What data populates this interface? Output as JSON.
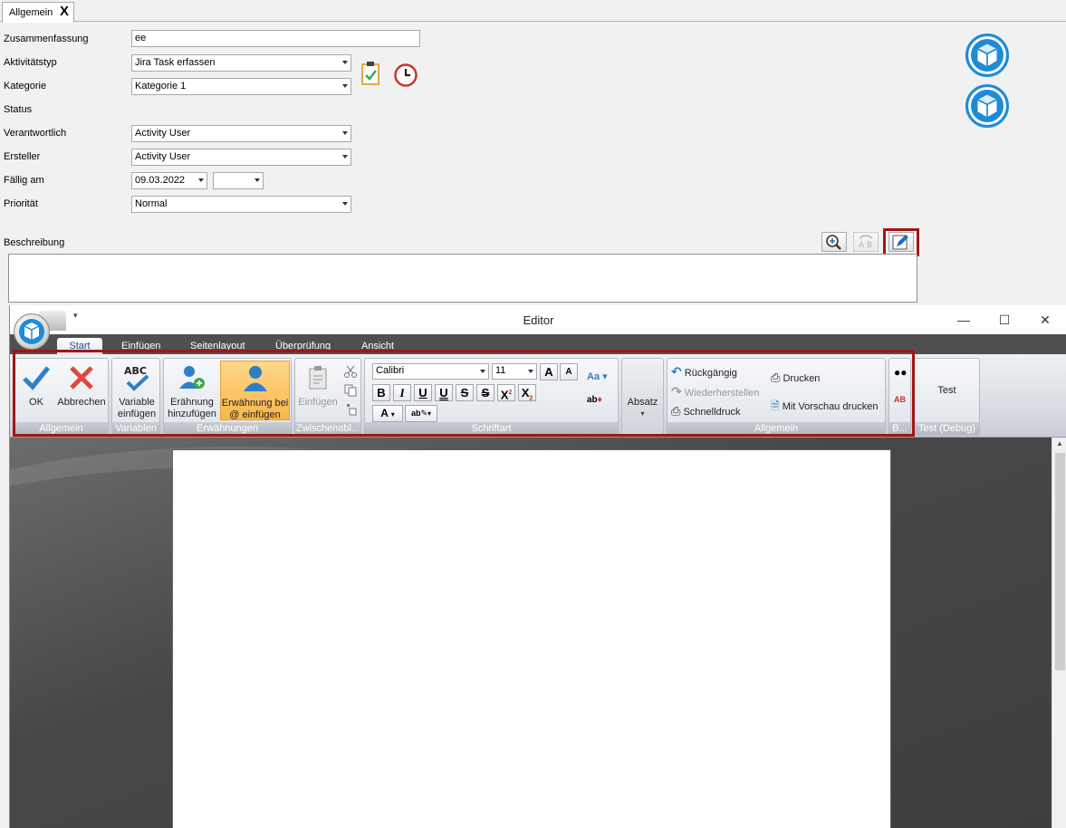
{
  "tab": {
    "label": "Allgemein",
    "close": "X"
  },
  "form": {
    "labels": {
      "summary": "Zusammenfassung",
      "activity_type": "Aktivitätstyp",
      "category": "Kategorie",
      "status": "Status",
      "responsible": "Verantwortlich",
      "creator": "Ersteller",
      "due": "Fällig am",
      "priority": "Priorität",
      "description": "Beschreibung"
    },
    "values": {
      "summary": "ee",
      "activity_type": "Jira Task erfassen",
      "category": "Kategorie 1",
      "responsible": "Activity User",
      "creator": "Activity User",
      "due_date": "09.03.2022",
      "due_time": "",
      "priority": "Normal",
      "description": ""
    }
  },
  "editor": {
    "title": "Editor",
    "tabs": [
      "Start",
      "Einfügen",
      "Seitenlayout",
      "Überprüfung",
      "Ansicht"
    ],
    "groups": {
      "allgemein1": {
        "caption": "Allgemein",
        "ok": "OK",
        "cancel": "Abbrechen"
      },
      "variablen": {
        "caption": "Variablen",
        "insert": "Variable einfügen"
      },
      "erwaehnungen": {
        "caption": "Erwähnungen",
        "add": "Erähnung hinzufügen",
        "insert_at": "Erwähnung bei @ einfügen"
      },
      "zwischenablage": {
        "caption": "Zwischenabl...",
        "paste": "Einfügen"
      },
      "schriftart": {
        "caption": "Schriftart",
        "font": "Calibri",
        "size": "11"
      },
      "absatz": {
        "label": "Absatz"
      },
      "allgemein2": {
        "caption": "Allgemein",
        "undo": "Rückgängig",
        "redo": "Wiederherstellen",
        "quickprint": "Schnelldruck",
        "print": "Drucken",
        "preview_print": "Mit Vorschau drucken"
      },
      "b": {
        "caption": "B..."
      },
      "test": {
        "caption": "Test (Debug)",
        "label": "Test"
      }
    }
  },
  "colors": {
    "accent": "#1e8bd9",
    "highlight_frame": "#a31515",
    "mention_active": "#f8b64a"
  }
}
